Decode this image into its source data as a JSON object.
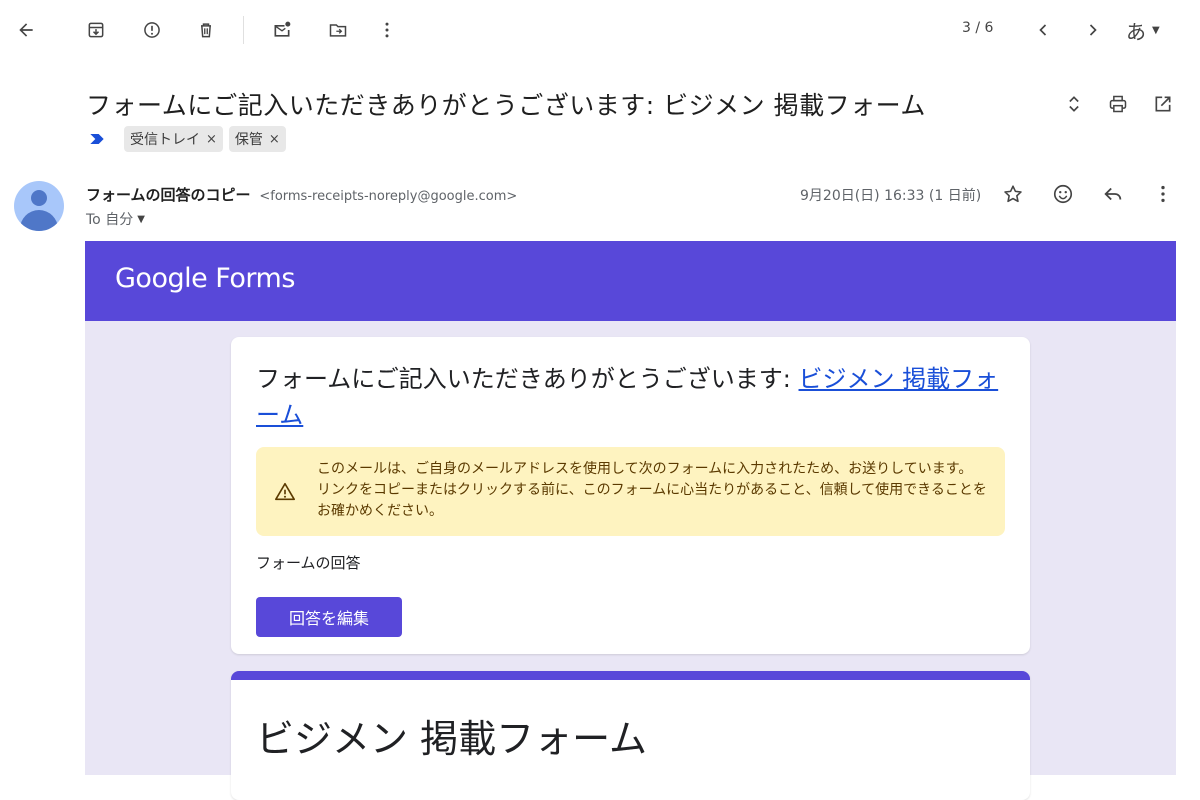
{
  "toolbar": {
    "pager": "3 / 6",
    "ime": "あ"
  },
  "email": {
    "subject": "フォームにご記入いただきありがとうございます: ビジメン 掲載フォーム",
    "labels": [
      "受信トレイ",
      "保管"
    ],
    "sender_name": "フォームの回答のコピー",
    "sender_email": "<forms-receipts-noreply@google.com>",
    "to": "To 自分",
    "date": "9月20日(日) 16:33 (1 日前)"
  },
  "forms": {
    "logo_google": "Google",
    "logo_forms": " Forms",
    "card_title_text": "フォームにご記入いただきありがとうございます: ",
    "card_title_link": "ビジメン 掲載フォーム",
    "warning": "このメールは、ご自身のメールアドレスを使用して次のフォームに入力されたため、お送りしています。 リンクをコピーまたはクリックする前に、このフォームに心当たりがあること、信頼して使用できることをお確かめください。",
    "response_label": "フォームの回答",
    "edit_button": "回答を編集",
    "form_title": "ビジメン 掲載フォーム"
  },
  "colors": {
    "accent": "#5848d9",
    "background_tint": "#e9e6f5",
    "warning_bg": "#fef3c0",
    "link": "#1a4fd8"
  }
}
